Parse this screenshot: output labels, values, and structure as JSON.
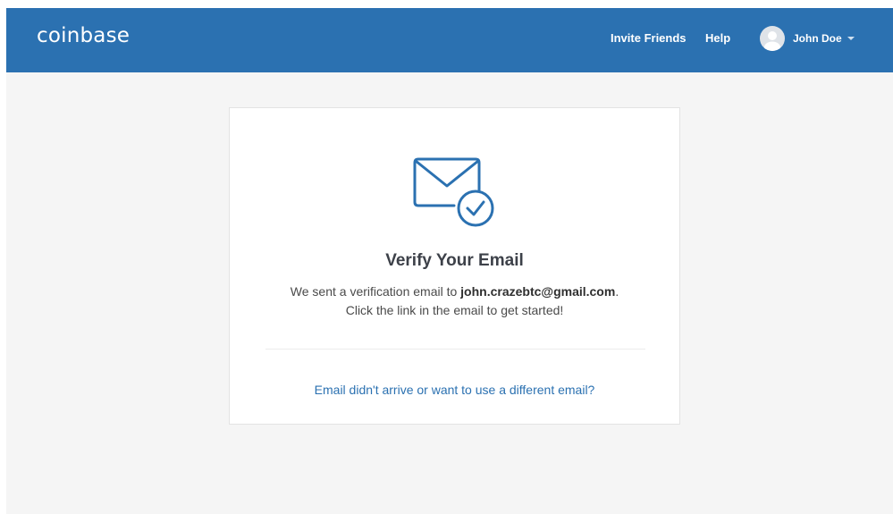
{
  "header": {
    "logo": "coinbase",
    "nav": {
      "invite_friends": "Invite Friends",
      "help": "Help"
    },
    "user": {
      "name": "John Doe",
      "avatar_icon": "user-avatar-icon",
      "dropdown_icon": "caret-down-icon"
    }
  },
  "verify_card": {
    "icon": "envelope-check-icon",
    "title": "Verify Your Email",
    "message_prefix": "We sent a verification email to ",
    "email": "john.crazebtc@gmail.com",
    "message_suffix": ".",
    "message_line2": "Click the link in the email to get started!",
    "resend_link": "Email didn't arrive or want to use a different email?"
  },
  "colors": {
    "header_bg": "#2b71b1",
    "page_bg": "#f5f5f5",
    "accent": "#2b71b1",
    "title_text": "#3d4149"
  }
}
